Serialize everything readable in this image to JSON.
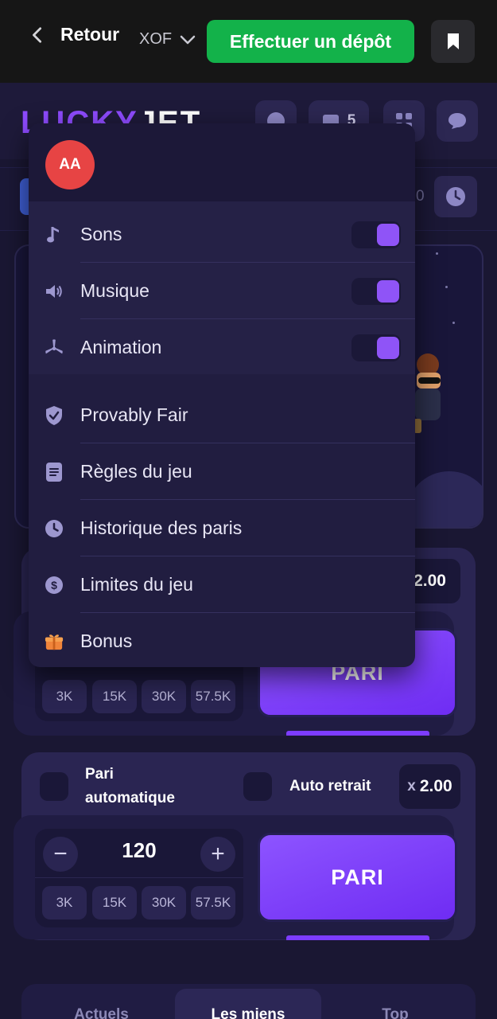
{
  "topbar": {
    "back_label": "Retour",
    "currency": "XOF",
    "deposit_label": "Effectuer un dépôt"
  },
  "game": {
    "logo_part1": "LUCKY",
    "logo_part2": "JET",
    "header_counter": "5",
    "history_tail": "0"
  },
  "menu": {
    "avatar_initials": "AA",
    "toggles": [
      {
        "label": "Sons",
        "icon": "music-note-icon",
        "enabled": true
      },
      {
        "label": "Musique",
        "icon": "speaker-icon",
        "enabled": true
      },
      {
        "label": "Animation",
        "icon": "propeller-icon",
        "enabled": true
      }
    ],
    "links": [
      {
        "label": "Provably Fair",
        "icon": "shield-check-icon"
      },
      {
        "label": "Règles du jeu",
        "icon": "document-icon"
      },
      {
        "label": "Historique des paris",
        "icon": "clock-icon"
      },
      {
        "label": "Limites du jeu",
        "icon": "dollar-coin-icon"
      },
      {
        "label": "Bonus",
        "icon": "gift-icon"
      }
    ]
  },
  "bet1": {
    "multiplier": "2.00",
    "quick_amounts": [
      "3K",
      "15K",
      "30K",
      "57.5K"
    ],
    "button_label": "PARI"
  },
  "bet2": {
    "auto_bet_line1": "Pari",
    "auto_bet_line2": "automatique",
    "auto_cashout_label": "Auto retrait",
    "multiplier_prefix": "x",
    "multiplier": "2.00",
    "amount": "120",
    "minus": "−",
    "plus": "+",
    "quick_amounts": [
      "3K",
      "15K",
      "30K",
      "57.5K"
    ],
    "button_label": "PARI"
  },
  "tabs": [
    "Actuels",
    "Les miens",
    "Top"
  ],
  "active_tab": "Les miens",
  "colors": {
    "accent": "#8f54f7",
    "deposit": "#13b24a",
    "avatar": "#e74444",
    "background": "#1a1733"
  }
}
